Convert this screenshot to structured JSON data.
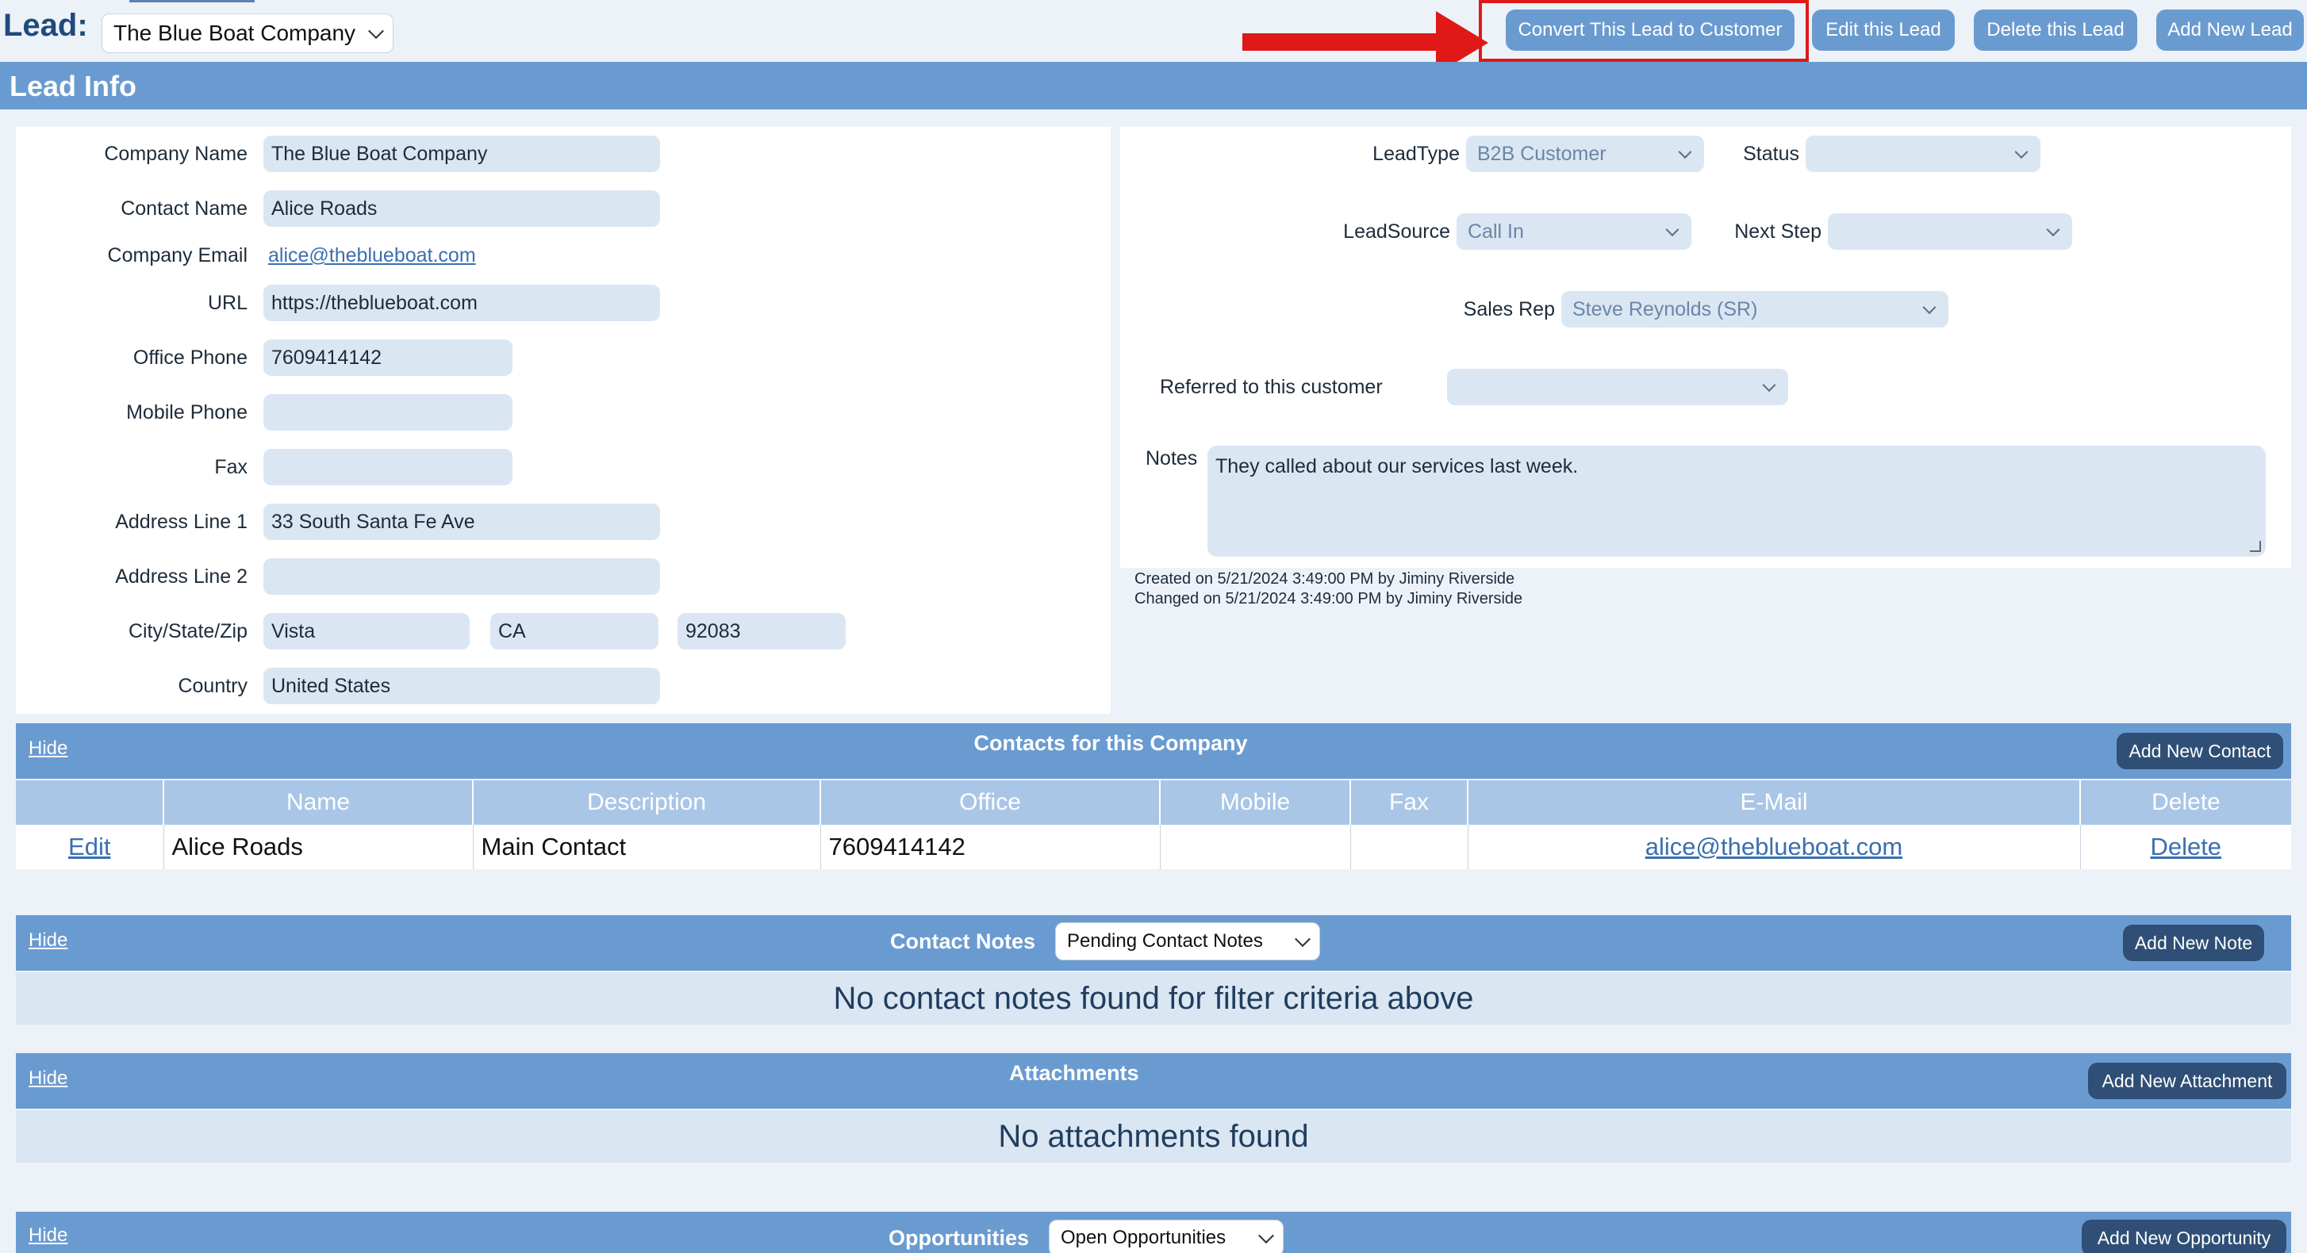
{
  "header": {
    "lead_label": "Lead:",
    "lead_select_value": "The Blue Boat Company",
    "buttons": {
      "convert": "Convert This Lead to Customer",
      "edit": "Edit this Lead",
      "delete": "Delete this Lead",
      "add_new": "Add New Lead"
    }
  },
  "lead_info": {
    "title": "Lead Info",
    "left": {
      "company_name_label": "Company Name",
      "company_name": "The Blue Boat Company",
      "contact_name_label": "Contact Name",
      "contact_name": "Alice Roads",
      "company_email_label": "Company Email",
      "company_email": "alice@theblueboat.com",
      "url_label": "URL",
      "url": "https://theblueboat.com",
      "office_phone_label": "Office Phone",
      "office_phone": "7609414142",
      "mobile_phone_label": "Mobile Phone",
      "mobile_phone": "",
      "fax_label": "Fax",
      "fax": "",
      "address1_label": "Address Line 1",
      "address1": "33 South Santa Fe Ave",
      "address2_label": "Address Line 2",
      "address2": "",
      "csz_label": "City/State/Zip",
      "city": "Vista",
      "state": "CA",
      "zip": "92083",
      "country_label": "Country",
      "country": "United States"
    },
    "right": {
      "leadtype_label": "LeadType",
      "leadtype": "B2B Customer",
      "status_label": "Status",
      "status": "",
      "leadsource_label": "LeadSource",
      "leadsource": "Call In",
      "next_step_label": "Next Step",
      "next_step": "",
      "sales_rep_label": "Sales Rep",
      "sales_rep": "Steve Reynolds (SR)",
      "referred_label": "Referred to this customer",
      "referred": "",
      "notes_label": "Notes",
      "notes": "They called about our services last week.",
      "created": "Created on 5/21/2024 3:49:00 PM by Jiminy Riverside",
      "changed": "Changed on 5/21/2024 3:49:00 PM by Jiminy Riverside"
    }
  },
  "contacts": {
    "hide": "Hide",
    "title": "Contacts for this Company",
    "add_button": "Add New Contact",
    "columns": [
      "",
      "Name",
      "Description",
      "Office",
      "Mobile",
      "Fax",
      "E-Mail",
      "Delete"
    ],
    "rows": [
      {
        "edit": "Edit",
        "name": "Alice Roads",
        "description": "Main Contact",
        "office": "7609414142",
        "mobile": "",
        "fax": "",
        "email": "alice@theblueboat.com",
        "delete": "Delete"
      }
    ]
  },
  "contact_notes": {
    "hide": "Hide",
    "title": "Contact Notes",
    "filter": "Pending Contact Notes",
    "add_button": "Add New Note",
    "empty": "No contact notes found for filter criteria above"
  },
  "attachments": {
    "hide": "Hide",
    "title": "Attachments",
    "add_button": "Add New Attachment",
    "empty": "No attachments found"
  },
  "opportunities": {
    "hide": "Hide",
    "title": "Opportunities",
    "filter": "Open Opportunities",
    "add_button": "Add New Opportunity"
  },
  "colors": {
    "accent": "#6a9bd0",
    "dark_button": "#2f4f76",
    "field_bg": "#dbe6f3",
    "annotation_red": "#e01818"
  }
}
